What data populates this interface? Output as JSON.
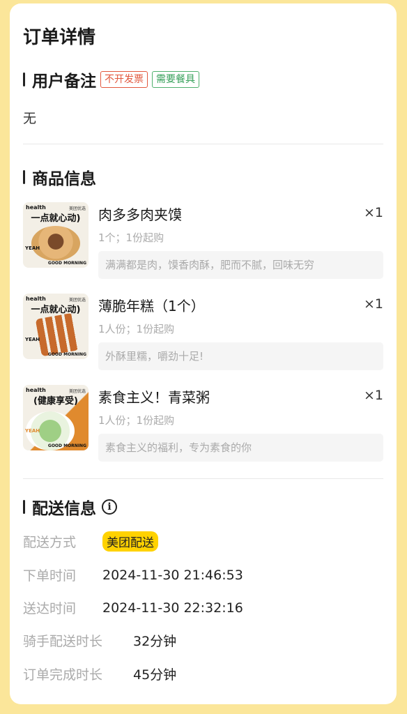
{
  "page_title": "订单详情",
  "remarks": {
    "title": "用户备注",
    "tags": [
      "不开发票",
      "需要餐具"
    ],
    "note": "无"
  },
  "products": {
    "title": "商品信息",
    "items": [
      {
        "name": "肉多多肉夹馍",
        "qty": "×1",
        "spec": "1个；1份起购",
        "desc": "满满都是肉，馍香肉酥，肥而不腻，回味无穷",
        "thumb": {
          "brand": "health",
          "brand2": "美团优选",
          "slogan": "一点就心动)",
          "yeah": "YEAH",
          "morning": "GOOD MORNING",
          "food_color": "#d8a560"
        }
      },
      {
        "name": "薄脆年糕（1个）",
        "qty": "×1",
        "spec": "1人份；1份起购",
        "desc": "外酥里糯，嚼劲十足!",
        "thumb": {
          "brand": "health",
          "brand2": "美团优选",
          "slogan": "一点就心动)",
          "yeah": "YEAH",
          "morning": "GOOD MORNING",
          "food_color": "#c76a2c"
        }
      },
      {
        "name": "素食主义！青菜粥",
        "qty": "×1",
        "spec": "1人份；1份起购",
        "desc": "素食主义的福利，专为素食的你",
        "thumb": {
          "brand": "health",
          "brand2": "美团优选",
          "slogan": "(健康享受)",
          "yeah": "YEAH",
          "morning": "GOOD MORNING",
          "food_color": "#9fcf85"
        }
      }
    ]
  },
  "delivery": {
    "title": "配送信息",
    "rows": [
      {
        "label": "配送方式",
        "value": "美团配送"
      },
      {
        "label": "下单时间",
        "value": "2024-11-30 21:46:53"
      },
      {
        "label": "送达时间",
        "value": "2024-11-30 22:32:16"
      },
      {
        "label": "骑手配送时长",
        "value": "32分钟"
      },
      {
        "label": "订单完成时长",
        "value": "45分钟"
      }
    ]
  },
  "colors": {
    "background": "#fbe69a",
    "accent_yellow": "#ffd200",
    "tag_red": "#e2583e",
    "tag_green": "#36a05a"
  },
  "icons": {
    "info": "info-circle-icon"
  }
}
